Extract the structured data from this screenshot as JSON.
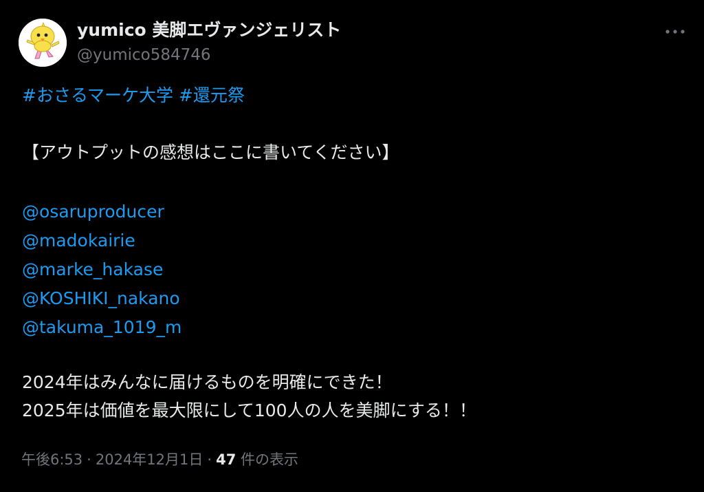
{
  "author": {
    "display_name": "yumico 美脚エヴァンジェリスト",
    "handle": "@yumico584746",
    "avatar_icon": "bird-character-avatar"
  },
  "more_button": {
    "icon": "more-horizontal-icon"
  },
  "tweet": {
    "hashtags": [
      "#おさるマーケ大学",
      "#還元祭"
    ],
    "headline": "【アウトプットの感想はここに書いてください】",
    "mentions": [
      "@osaruproducer",
      "@madokairie",
      "@marke_hakase",
      "@KOSHIKI_nakano",
      "@takuma_1019_m"
    ],
    "closing_lines": [
      "2024年はみんなに届けるものを明確にできた！",
      "2025年は価値を最大限にして100人の人を美脚にする！！"
    ]
  },
  "meta": {
    "time": "午後6:53",
    "separator": "·",
    "date": "2024年12月1日",
    "views_count": "47",
    "views_label": "件の表示"
  },
  "colors": {
    "background": "#000000",
    "text": "#e7e9ea",
    "link": "#1d9bf0",
    "muted": "#71767b"
  }
}
